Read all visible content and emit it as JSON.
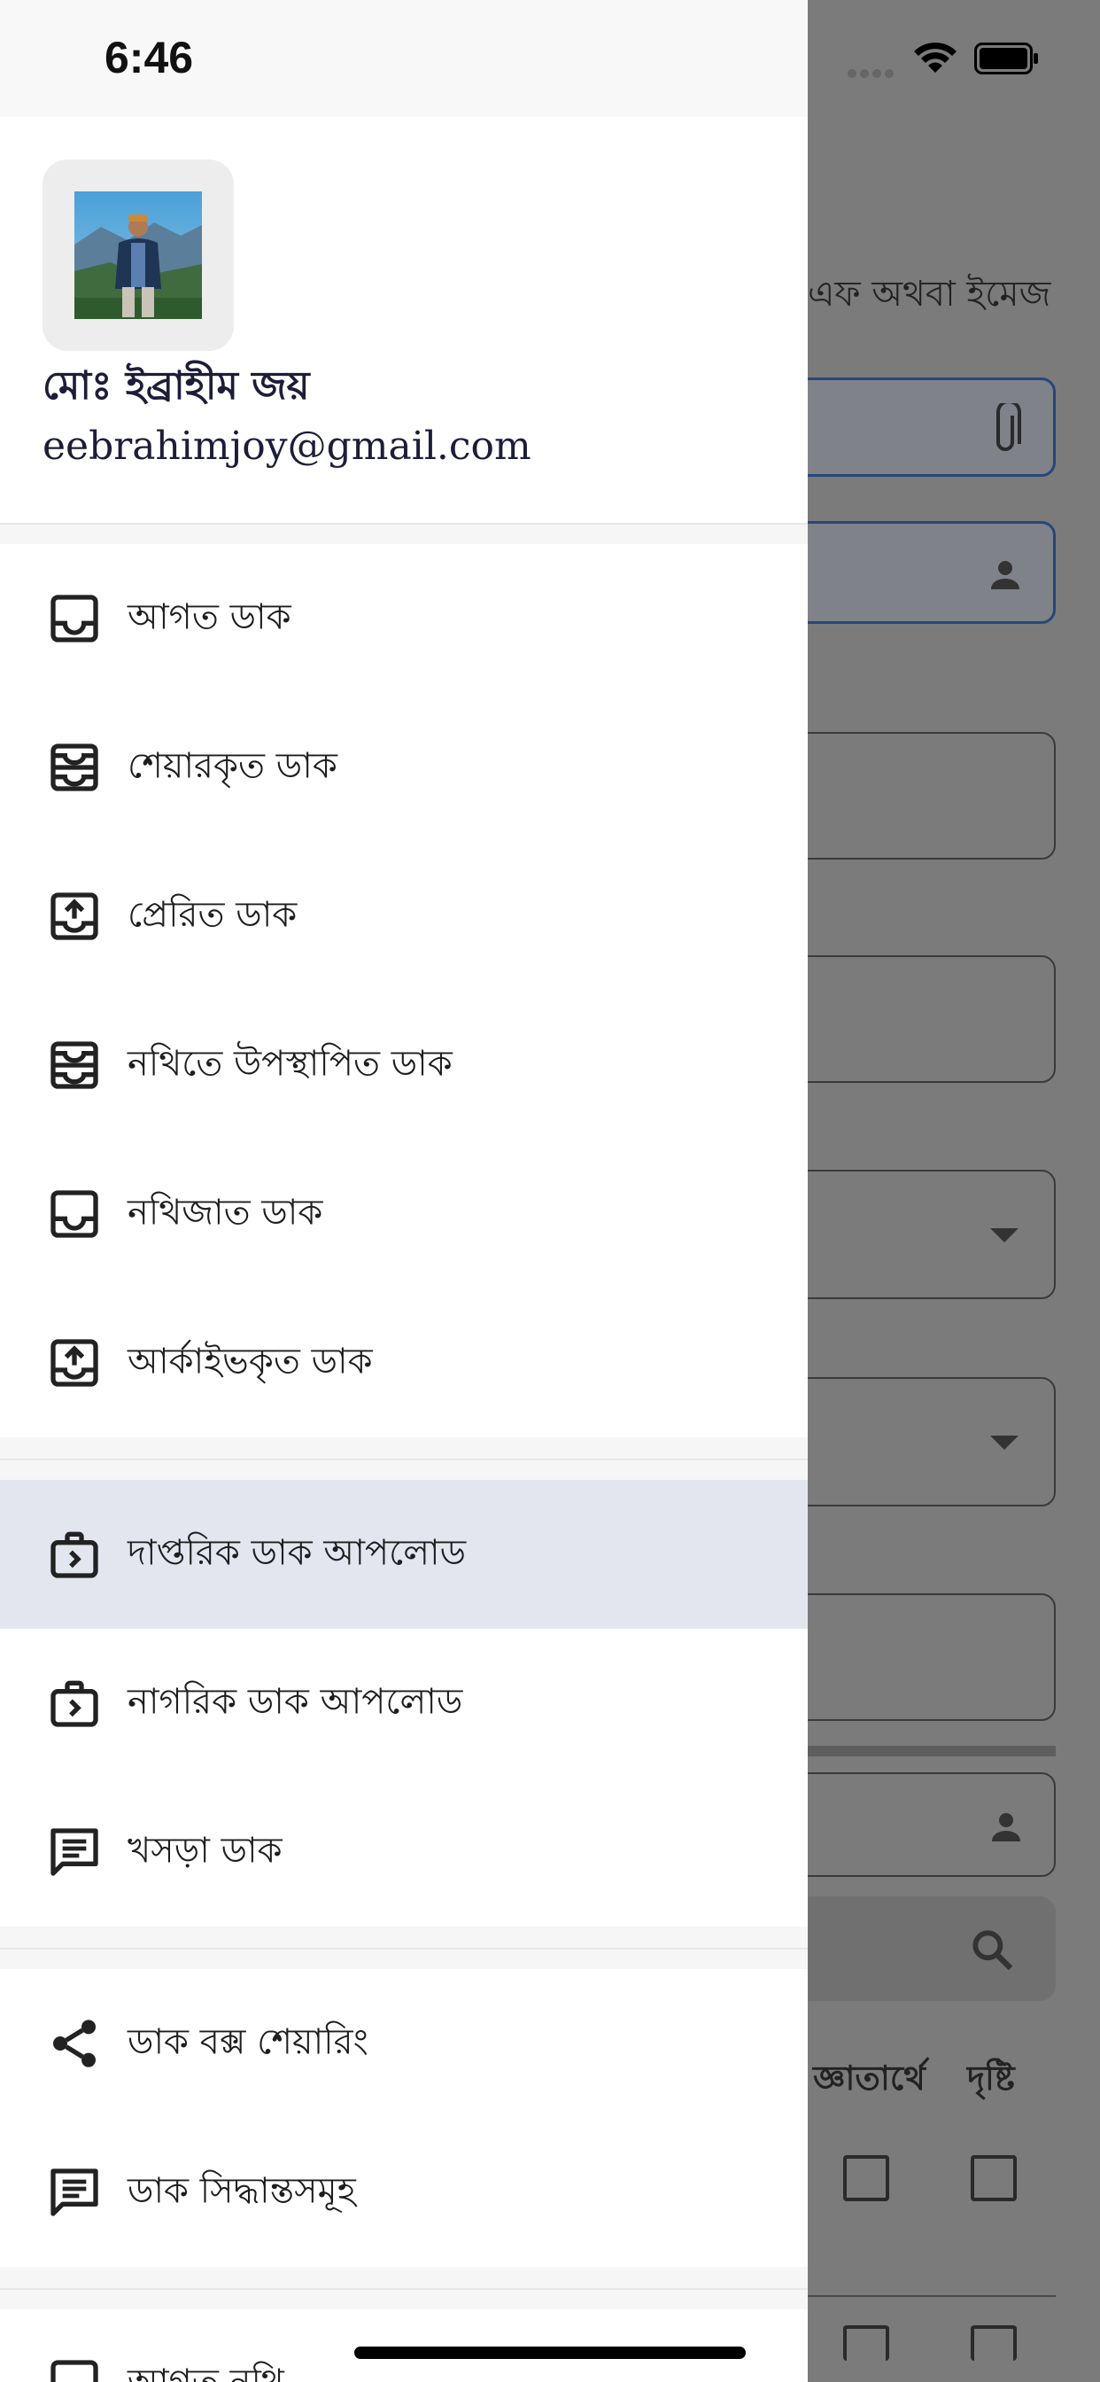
{
  "status_bar": {
    "time": "6:46"
  },
  "profile": {
    "name": "মোঃ ইব্রাহীম জয়",
    "email": "eebrahimjoy@gmail.com"
  },
  "menu": {
    "section1": [
      {
        "label": "আগত ডাক",
        "icon": "inbox-icon"
      },
      {
        "label": "শেয়ারকৃত ডাক",
        "icon": "shared-tray-icon"
      },
      {
        "label": "প্রেরিত ডাক",
        "icon": "outbox-upload-icon"
      },
      {
        "label": "নথিতে উপস্থাপিত ডাক",
        "icon": "shared-tray-icon"
      },
      {
        "label": "নথিজাত ডাক",
        "icon": "inbox-icon"
      },
      {
        "label": "আর্কাইভকৃত ডাক",
        "icon": "outbox-upload-icon"
      }
    ],
    "section2": [
      {
        "label": "দাপ্তরিক ডাক আপলোড",
        "icon": "briefcase-upload-icon",
        "active": true
      },
      {
        "label": "নাগরিক ডাক আপলোড",
        "icon": "briefcase-upload-icon"
      },
      {
        "label": "খসড়া ডাক",
        "icon": "message-icon"
      }
    ],
    "section3": [
      {
        "label": "ডাক বক্স শেয়ারিং",
        "icon": "share-icon"
      },
      {
        "label": "ডাক সিদ্ধান্তসমূহ",
        "icon": "message-icon"
      }
    ],
    "section4": [
      {
        "label": "আগত নথি",
        "icon": "inbox-icon"
      }
    ]
  },
  "background_screen": {
    "attachment_hint": "এফ অথবা ইমেজ",
    "col_info": "জ্ঞাতার্থে",
    "col_view": "দৃষ্টি"
  },
  "colors": {
    "active_item_bg": "#e3e6ef",
    "overlay": "#7b7b7b",
    "text_primary": "#1d1d3a"
  }
}
